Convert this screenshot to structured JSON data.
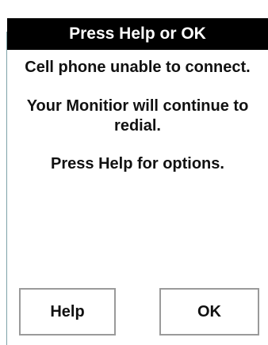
{
  "dialog": {
    "title": "Press Help or OK",
    "messages": [
      "Cell phone unable to connect.",
      "Your Monitior will continue to redial.",
      "Press Help for options."
    ],
    "buttons": {
      "help_label": "Help",
      "ok_label": "OK"
    }
  },
  "colors": {
    "title_bar_bg": "#000000",
    "title_bar_text": "#ffffff",
    "button_border": "#9a9a9a"
  }
}
